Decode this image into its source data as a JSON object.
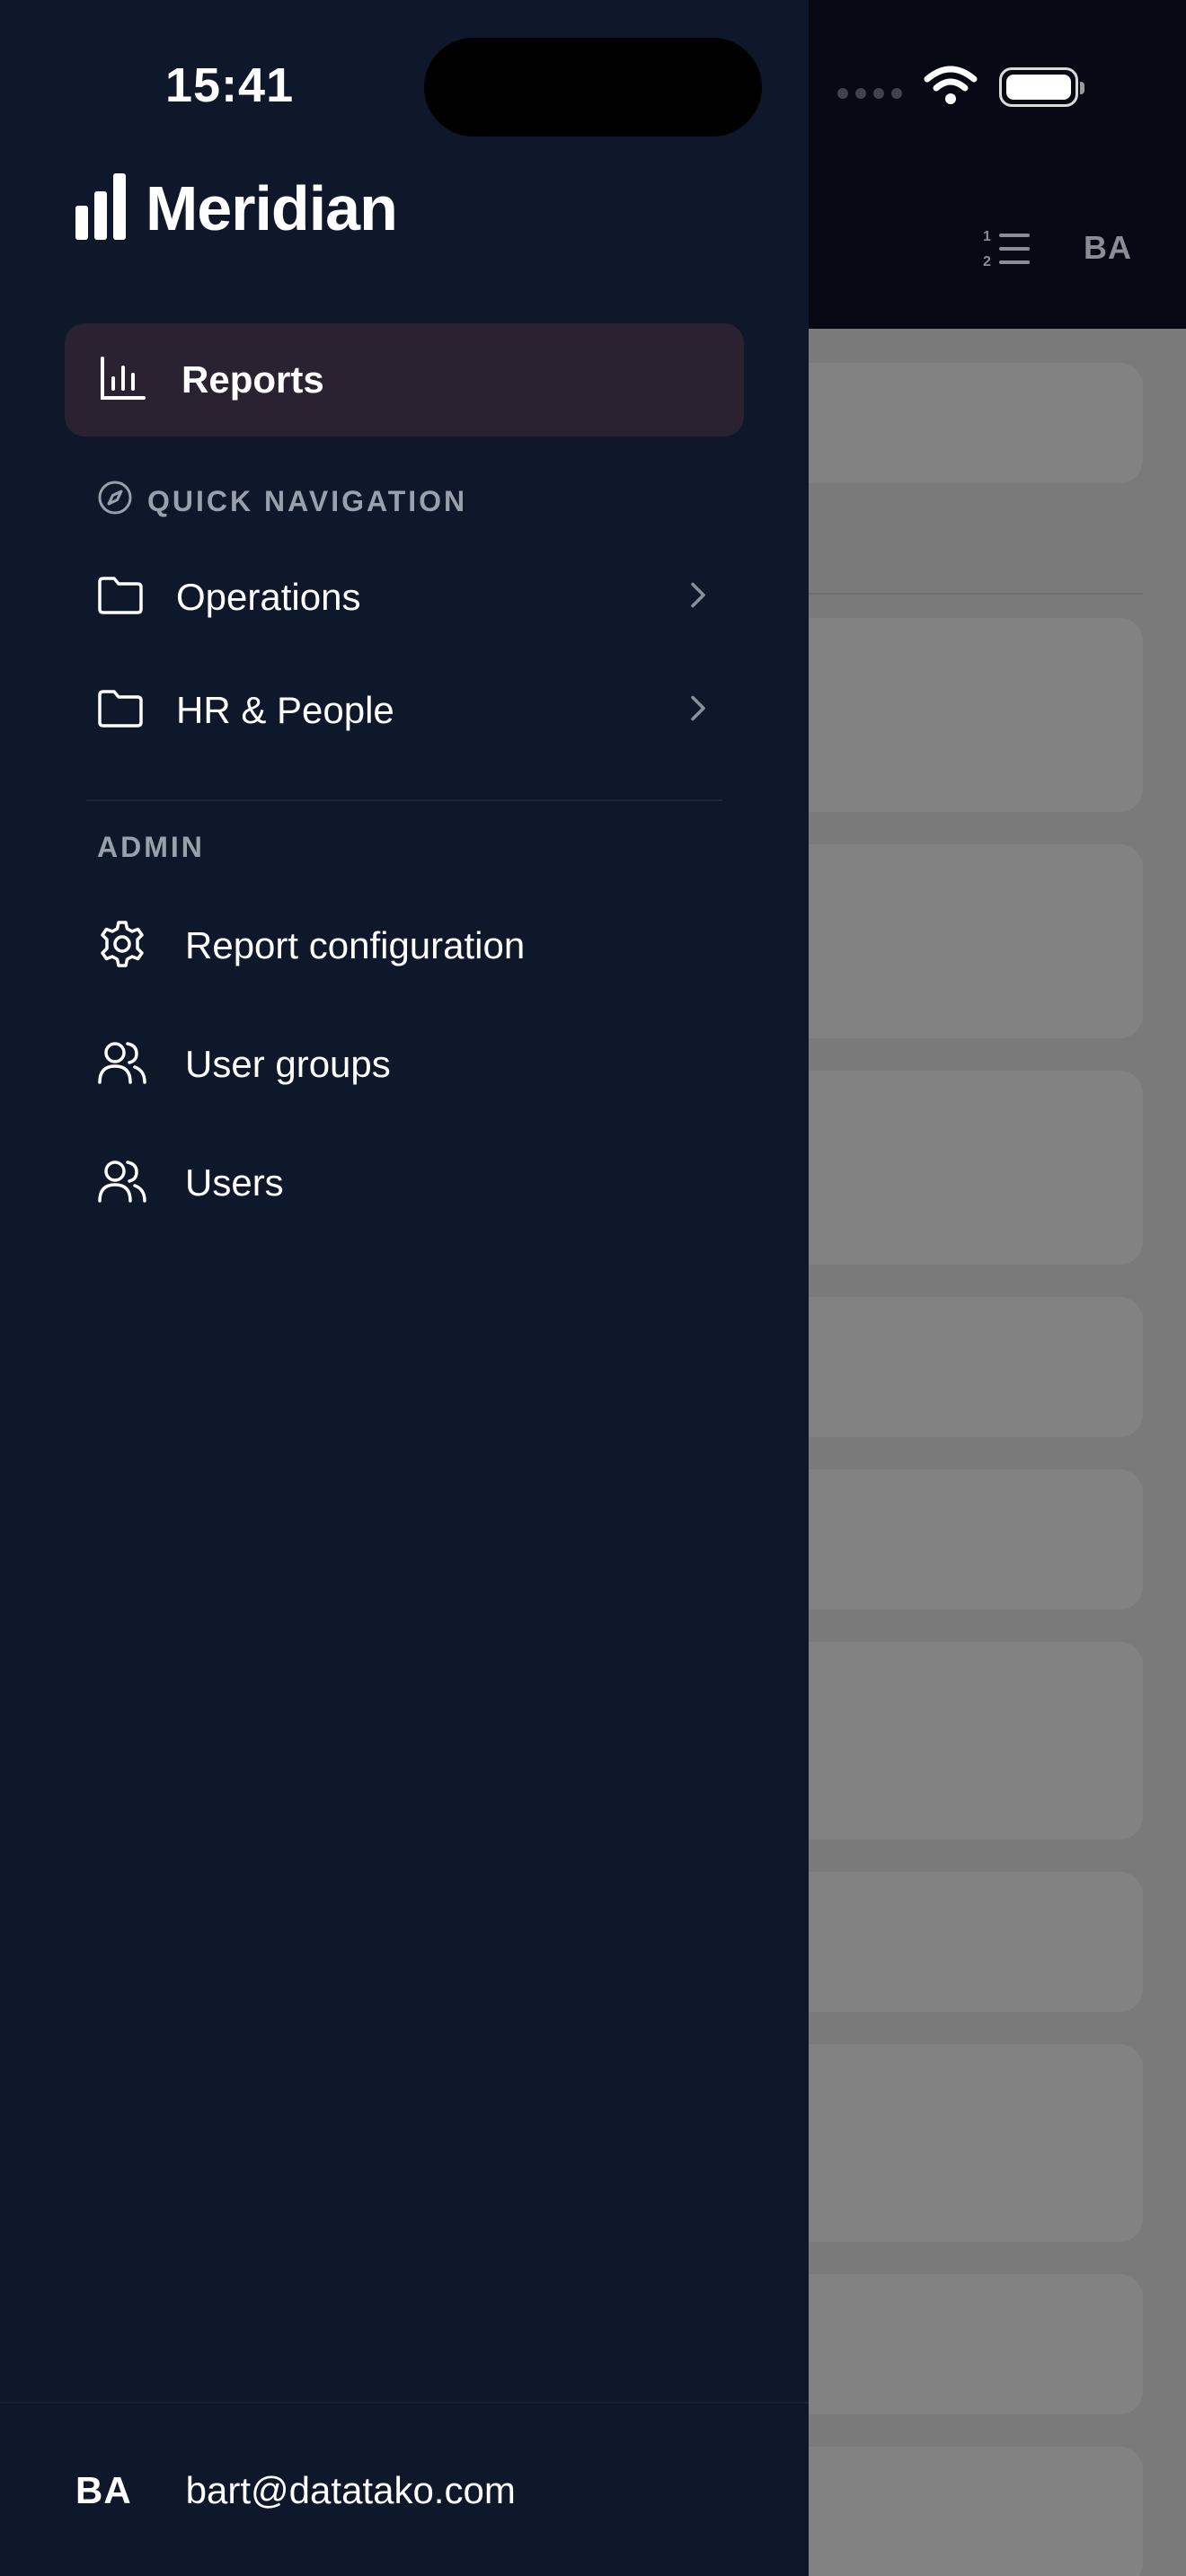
{
  "status_bar": {
    "time": "15:41"
  },
  "brand": {
    "name": "Meridian"
  },
  "nav": {
    "active_item": {
      "label": "Reports",
      "icon": "bar-chart-icon"
    },
    "quick_navigation": {
      "header": "QUICK NAVIGATION",
      "icon": "compass-icon",
      "items": [
        {
          "label": "Operations",
          "icon": "folder-icon"
        },
        {
          "label": "HR & People",
          "icon": "folder-icon"
        }
      ]
    },
    "admin": {
      "header": "ADMIN",
      "items": [
        {
          "label": "Report configuration",
          "icon": "gear-icon"
        },
        {
          "label": "User groups",
          "icon": "users-icon"
        },
        {
          "label": "Users",
          "icon": "users-icon"
        }
      ]
    }
  },
  "footer": {
    "initials": "BA",
    "email": "bart@datatako.com"
  },
  "background_app": {
    "avatar_initials": "BA",
    "toolbar_icon": "numbered-list-icon"
  },
  "colors": {
    "drawer_bg": "#0f172a",
    "active_item_bg": "#2b2231",
    "section_header": "#9aa0ab",
    "overlay": "#7a7a7a"
  }
}
